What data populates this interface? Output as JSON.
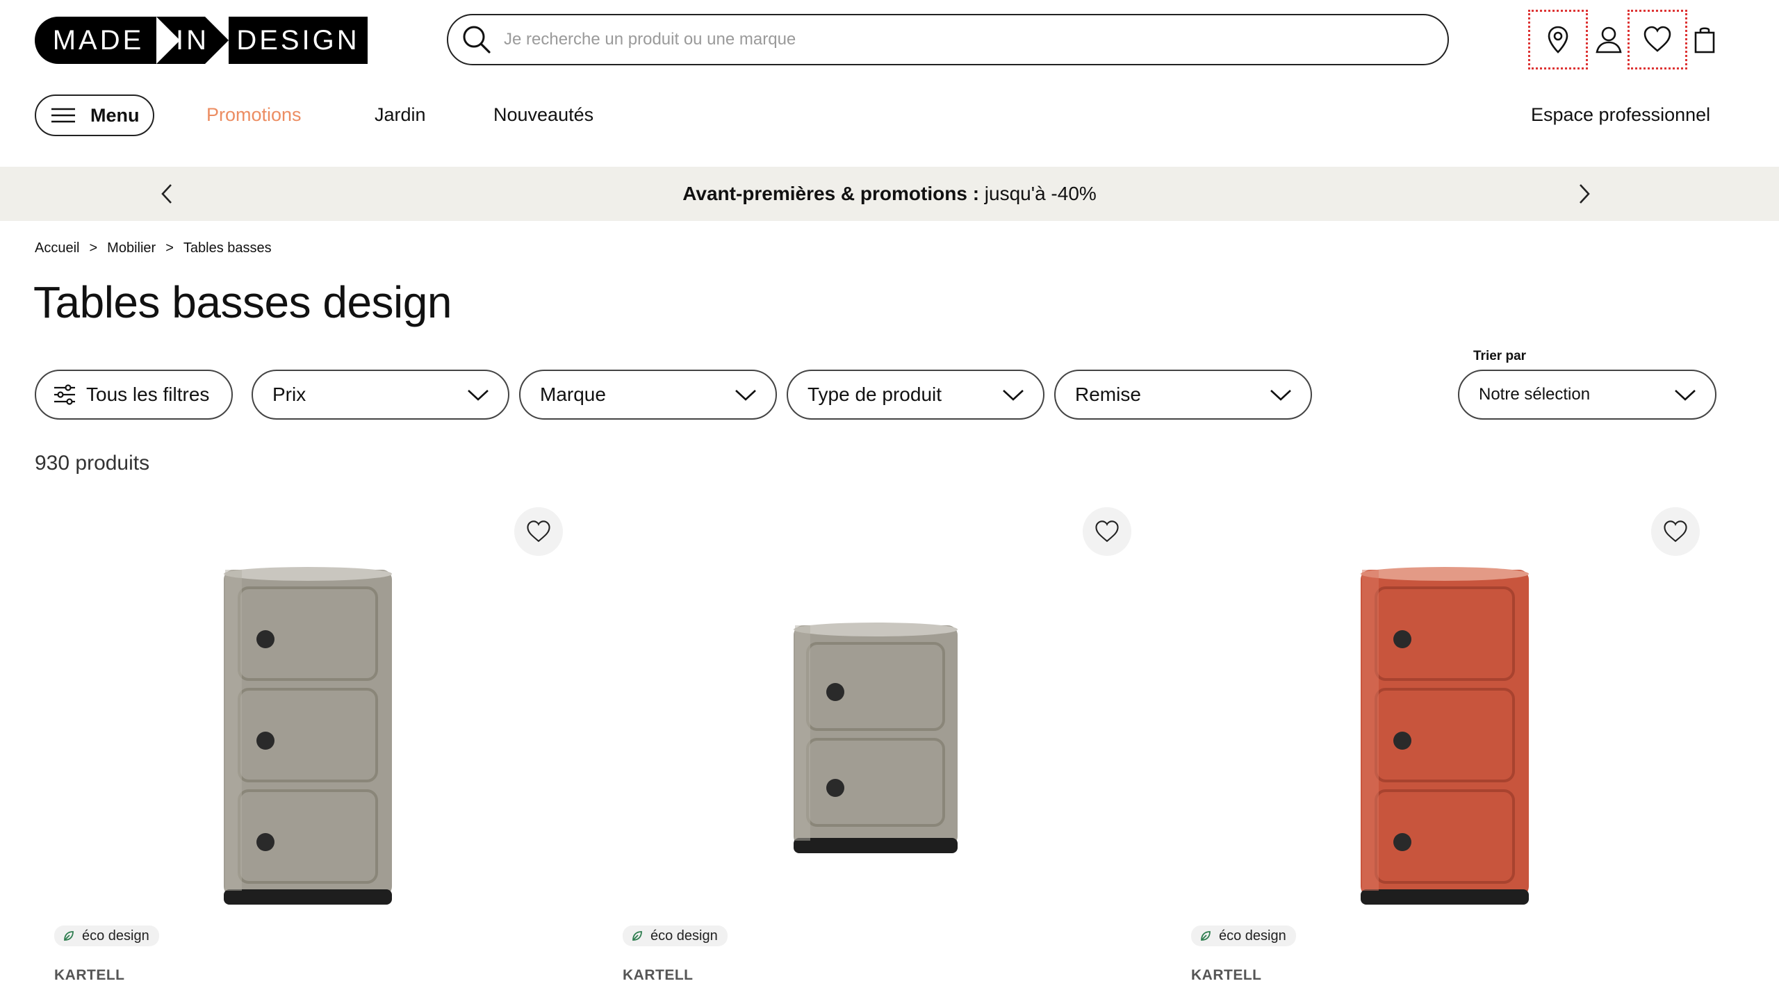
{
  "header": {
    "logo": [
      "MADE",
      "IN",
      "DESIGN"
    ],
    "search_placeholder": "Je recherche un produit ou une marque"
  },
  "nav": {
    "menu_label": "Menu",
    "links": [
      "Promotions",
      "Jardin",
      "Nouveautés"
    ],
    "pro_link": "Espace professionnel",
    "promo_color": "#ec8d62"
  },
  "banner": {
    "bold": "Avant-premières & promotions :",
    "rest": " jusqu'à -40%"
  },
  "breadcrumb": [
    "Accueil",
    ">",
    "Mobilier",
    ">",
    "Tables basses"
  ],
  "page_title": "Tables basses design",
  "filters": {
    "all": "Tous les filtres",
    "items": [
      "Prix",
      "Marque",
      "Type de produit",
      "Remise"
    ],
    "sort_label": "Trier par",
    "sort_value": "Notre sélection"
  },
  "product_count": "930 produits",
  "products": [
    {
      "badge": "éco design",
      "brand": "KARTELL",
      "color": "#a09c92"
    },
    {
      "badge": "éco design",
      "brand": "KARTELL",
      "color": "#a09c92"
    },
    {
      "badge": "éco design",
      "brand": "KARTELL",
      "color": "#c8553d"
    }
  ]
}
